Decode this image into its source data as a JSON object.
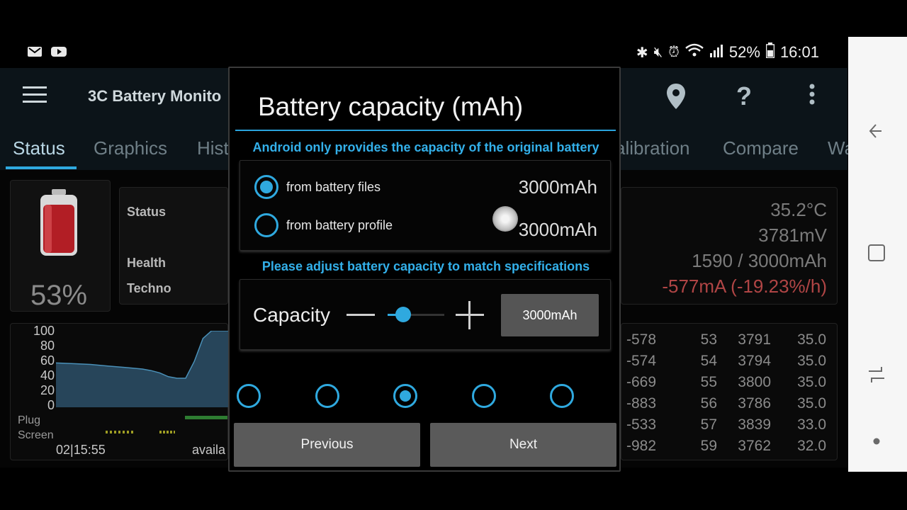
{
  "status_bar": {
    "notif_icons": [
      "gmail-icon",
      "youtube-icon"
    ],
    "system_icons": [
      "bluetooth-icon",
      "mute-icon",
      "alarm-icon",
      "wifi-icon",
      "signal-icon"
    ],
    "battery_percent": "52%",
    "time": "16:01"
  },
  "app_bar": {
    "title": "3C Battery Monito",
    "actions": [
      "grid-icon",
      "location-icon",
      "help-icon",
      "overflow-icon"
    ]
  },
  "tabs": [
    "Status",
    "Graphics",
    "Hist",
    "alibration",
    "Compare",
    "Wa"
  ],
  "active_tab": "Status",
  "status_card": {
    "percent": "53%",
    "labels": [
      "Status",
      "Health",
      "Techno"
    ],
    "right_values": [
      "35.2°C",
      "3781mV",
      "1590 / 3000mAh",
      "-577mA (-19.23%/h)"
    ]
  },
  "graph": {
    "y_ticks": [
      "100",
      "80",
      "60",
      "40",
      "20",
      "0"
    ],
    "legend": [
      "Plug",
      "Screen"
    ],
    "x_start": "02|15:55",
    "x_mid": "availa",
    "chart_data": {
      "type": "area",
      "title": "",
      "ylim": [
        0,
        100
      ],
      "x": [
        0,
        10,
        20,
        30,
        40,
        50,
        55,
        60,
        65,
        70,
        75,
        80,
        85,
        90,
        95,
        100
      ],
      "values": [
        58,
        57,
        56,
        54,
        52,
        50,
        48,
        45,
        40,
        38,
        38,
        60,
        90,
        100,
        100,
        100
      ]
    }
  },
  "table": {
    "rows": [
      [
        "-578",
        "53",
        "3791",
        "35.0"
      ],
      [
        "-574",
        "54",
        "3794",
        "35.0"
      ],
      [
        "-669",
        "55",
        "3800",
        "35.0"
      ],
      [
        "-883",
        "56",
        "3786",
        "35.0"
      ],
      [
        "-533",
        "57",
        "3839",
        "33.0"
      ],
      [
        "-982",
        "59",
        "3762",
        "32.0"
      ]
    ]
  },
  "dialog": {
    "title": "Battery capacity (mAh)",
    "info_top": "Android only provides the capacity of the original battery",
    "options": [
      {
        "label": "from battery files",
        "value": "3000mAh",
        "selected": true
      },
      {
        "label": "from battery profile",
        "value": "3000mAh",
        "selected": false
      }
    ],
    "info_bottom": "Please adjust battery capacity to match specifications",
    "capacity_label": "Capacity",
    "capacity_value": "3000mAh",
    "slider_level": 0.27,
    "page_count": 5,
    "current_page": 3,
    "previous_label": "Previous",
    "next_label": "Next"
  },
  "nav_bar": [
    "back-icon",
    "recents-icon",
    "switch-icon",
    "home-dot-icon"
  ],
  "colors": {
    "accent": "#2fa9df",
    "negative": "#b04545"
  }
}
